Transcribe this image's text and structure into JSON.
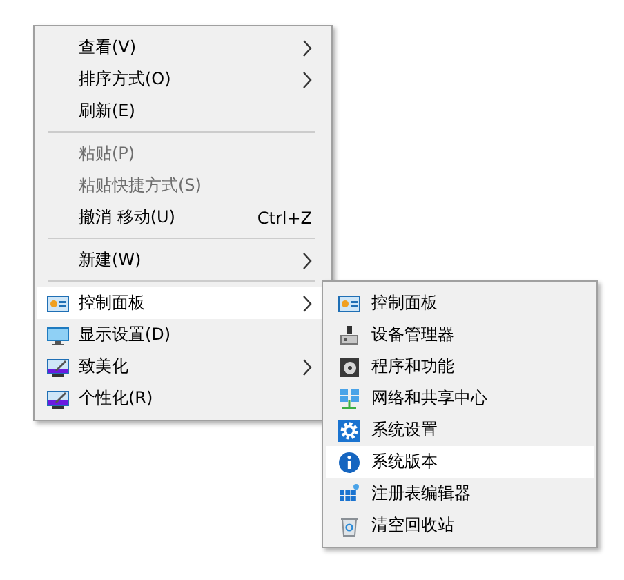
{
  "context_menu": {
    "items": [
      {
        "kind": "item",
        "label": "查看(V)",
        "has_submenu": true,
        "disabled": false,
        "selected": false
      },
      {
        "kind": "item",
        "label": "排序方式(O)",
        "has_submenu": true,
        "disabled": false,
        "selected": false
      },
      {
        "kind": "item",
        "label": "刷新(E)",
        "has_submenu": false,
        "disabled": false,
        "selected": false
      },
      {
        "kind": "separator"
      },
      {
        "kind": "item",
        "label": "粘贴(P)",
        "has_submenu": false,
        "disabled": true,
        "selected": false
      },
      {
        "kind": "item",
        "label": "粘贴快捷方式(S)",
        "has_submenu": false,
        "disabled": true,
        "selected": false
      },
      {
        "kind": "item",
        "label": "撤消 移动(U)",
        "shortcut": "Ctrl+Z",
        "has_submenu": false,
        "disabled": false,
        "selected": false
      },
      {
        "kind": "separator"
      },
      {
        "kind": "item",
        "label": "新建(W)",
        "has_submenu": true,
        "disabled": false,
        "selected": false
      },
      {
        "kind": "separator"
      },
      {
        "kind": "item",
        "label": "控制面板",
        "has_submenu": true,
        "disabled": false,
        "selected": true
      },
      {
        "kind": "item",
        "label": "显示设置(D)",
        "has_submenu": false,
        "disabled": false,
        "selected": false
      },
      {
        "kind": "item",
        "label": "致美化",
        "has_submenu": true,
        "disabled": false,
        "selected": false
      },
      {
        "kind": "item",
        "label": "个性化(R)",
        "has_submenu": false,
        "disabled": false,
        "selected": false
      }
    ]
  },
  "submenu": {
    "items": [
      {
        "label": "控制面板",
        "selected": false
      },
      {
        "label": "设备管理器",
        "selected": false
      },
      {
        "label": "程序和功能",
        "selected": false
      },
      {
        "label": "网络和共享中心",
        "selected": false
      },
      {
        "label": "系统设置",
        "selected": false
      },
      {
        "label": "系统版本",
        "selected": true
      },
      {
        "label": "注册表编辑器",
        "selected": false
      },
      {
        "label": "清空回收站",
        "selected": false
      }
    ]
  }
}
